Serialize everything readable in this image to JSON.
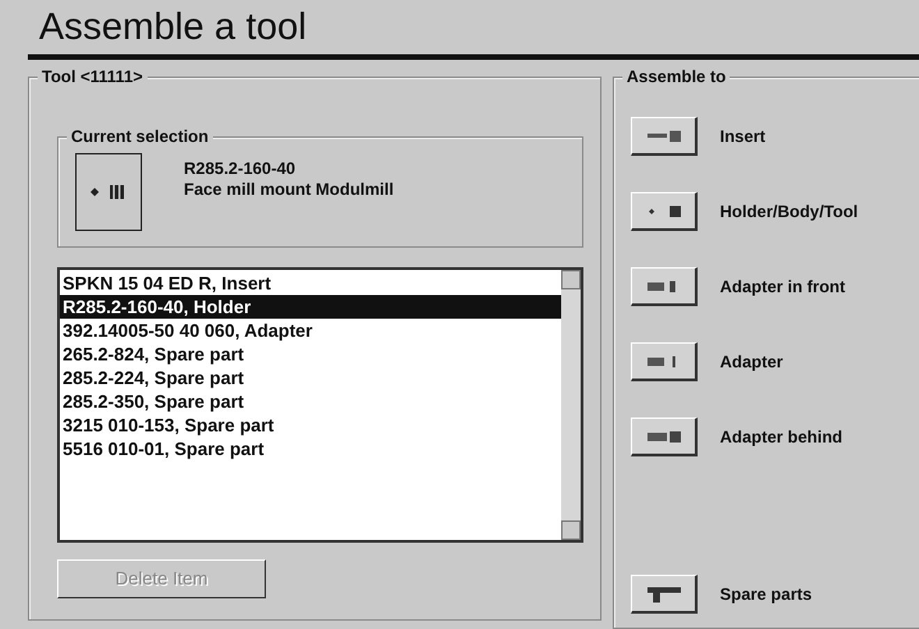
{
  "window": {
    "title": "Assemble a tool"
  },
  "tool_group": {
    "title": "Tool <11111>",
    "current_selection": {
      "title": "Current selection",
      "lines": [
        "R285.2-160-40",
        "Face mill mount Modulmill"
      ]
    },
    "list": [
      {
        "text": "SPKN 15 04 ED R, Insert",
        "selected": false
      },
      {
        "text": "R285.2-160-40, Holder",
        "selected": true
      },
      {
        "text": "392.14005-50 40 060, Adapter",
        "selected": false
      },
      {
        "text": "265.2-824, Spare part",
        "selected": false
      },
      {
        "text": "285.2-224, Spare part",
        "selected": false
      },
      {
        "text": "285.2-350, Spare part",
        "selected": false
      },
      {
        "text": "3215 010-153, Spare part",
        "selected": false
      },
      {
        "text": "5516 010-01, Spare part",
        "selected": false
      }
    ],
    "delete_button": {
      "label": "Delete Item",
      "disabled": true
    }
  },
  "assemble_group": {
    "title": "Assemble to",
    "items": [
      {
        "label": "Insert"
      },
      {
        "label": "Holder/Body/Tool"
      },
      {
        "label": "Adapter in front"
      },
      {
        "label": "Adapter"
      },
      {
        "label": "Adapter behind"
      },
      {
        "label": "Spare parts"
      }
    ]
  }
}
